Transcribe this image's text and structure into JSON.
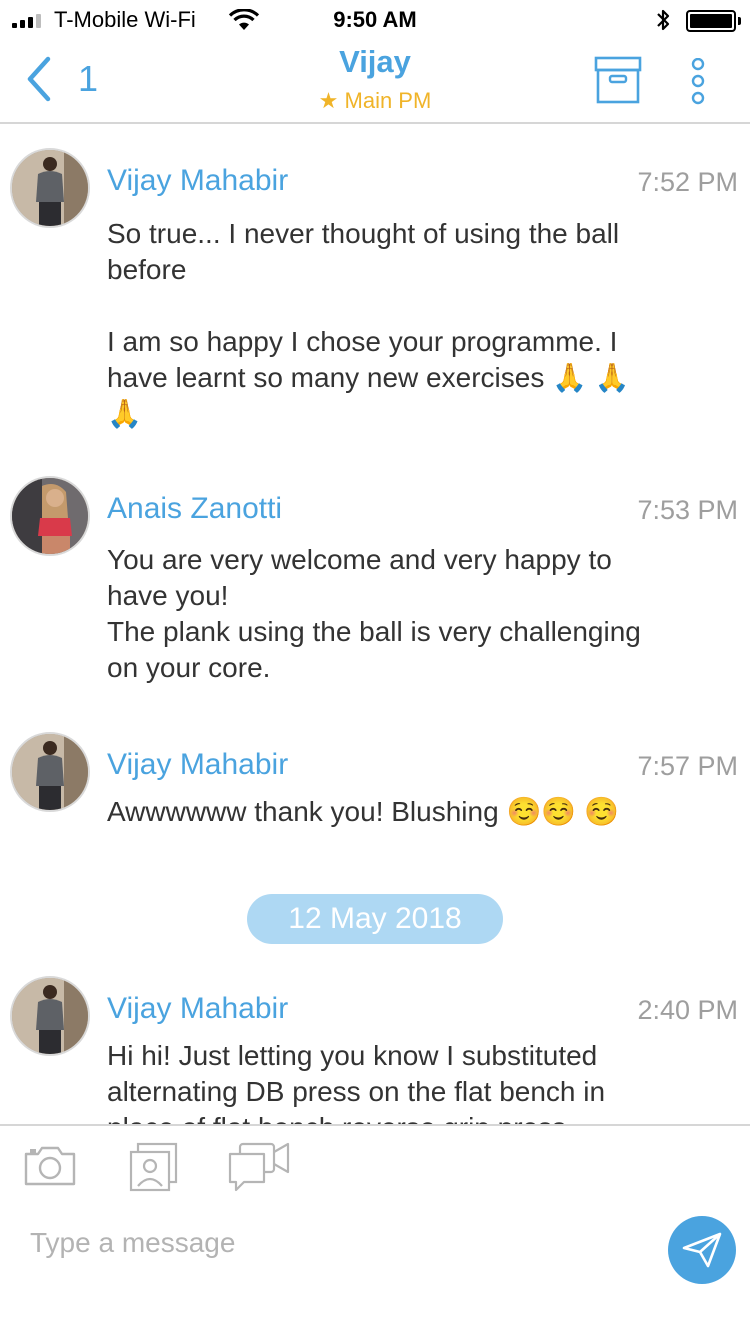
{
  "status_bar": {
    "carrier": "T-Mobile Wi-Fi",
    "time": "9:50 AM",
    "bluetooth_icon": "bluetooth-icon",
    "battery_level": 1.0
  },
  "nav": {
    "back_count": "1",
    "title": "Vijay",
    "subtitle": "★ Main PM",
    "icons": [
      "back-chevron-icon",
      "archive-icon",
      "more-vertical-icon"
    ]
  },
  "messages": [
    {
      "sender": "Vijay Mahabir",
      "time": "7:52 PM",
      "lines": [
        "So true... I never thought of using the ball before",
        "",
        "I am so happy I chose your programme. I have learnt so many new exercises 🙏 🙏🙏"
      ]
    },
    {
      "sender": "Anais Zanotti",
      "time": "7:53 PM",
      "lines": [
        "You are very welcome and very happy to have you!",
        "The plank using the ball is very challenging on your core."
      ]
    },
    {
      "sender": "Vijay Mahabir",
      "time": "7:57 PM",
      "lines": [
        "Awwwwww thank you! Blushing ☺️☺️ ☺️"
      ]
    },
    {
      "sender": "Vijay Mahabir",
      "time": "2:40 PM",
      "lines": [
        "Hi hi! Just letting you know I substituted alternating DB press on the flat bench in place of flat bench reverse grip press"
      ]
    }
  ],
  "date_divider": "12 May 2018",
  "composer": {
    "placeholder": "Type a message",
    "tools": [
      "camera-icon",
      "photo-gallery-icon",
      "video-chat-icon"
    ],
    "send_icon": "send-icon"
  },
  "colors": {
    "accent": "#4aa3df",
    "star": "#f0b429",
    "date_pill": "#aed8f3",
    "timestamp": "#9e9e9e"
  }
}
